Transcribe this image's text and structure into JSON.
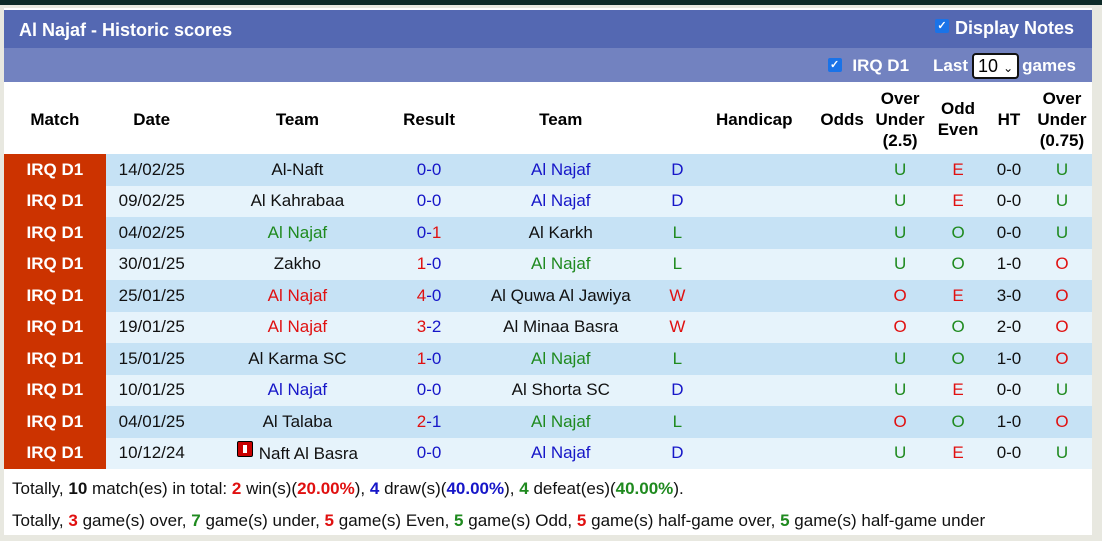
{
  "header": {
    "title": "Al Najaf - Historic scores",
    "display_notes_label": "Display Notes",
    "display_notes_checked": true
  },
  "filter": {
    "league_label": "IRQ D1",
    "league_checked": true,
    "last_label": "Last",
    "games_count": "10",
    "games_label": "games"
  },
  "columns": [
    "Match",
    "Date",
    "Team",
    "Result",
    "Team",
    "Handicap",
    "Odds",
    "Over Under (2.5)",
    "Odd Even",
    "HT",
    "Over Under (0.75)"
  ],
  "colors": {
    "league_bg": "#cc3300",
    "win": "#e01010",
    "draw": "#1616c8",
    "loss": "#1f8a1f"
  },
  "rows": [
    {
      "league": "IRQ D1",
      "date": "14/02/25",
      "home": "Al-Naft",
      "home_color": "",
      "hs": "0",
      "as": "0",
      "score_color": "blue",
      "away": "Al Najaf",
      "away_color": "blue",
      "wl": "D",
      "wl_color": "blue",
      "handicap": "",
      "odds": "",
      "ou": "U",
      "ou_color": "green",
      "oe": "E",
      "oe_color": "red",
      "ht": "0-0",
      "ou2": "U",
      "ou2_color": "green"
    },
    {
      "league": "IRQ D1",
      "date": "09/02/25",
      "home": "Al Kahrabaa",
      "home_color": "",
      "hs": "0",
      "as": "0",
      "score_color": "blue",
      "away": "Al Najaf",
      "away_color": "blue",
      "wl": "D",
      "wl_color": "blue",
      "handicap": "",
      "odds": "",
      "ou": "U",
      "ou_color": "green",
      "oe": "E",
      "oe_color": "red",
      "ht": "0-0",
      "ou2": "U",
      "ou2_color": "green"
    },
    {
      "league": "IRQ D1",
      "date": "04/02/25",
      "home": "Al Najaf",
      "home_color": "green",
      "hs": "0",
      "as": "1",
      "score_color": "away-red",
      "away": "Al Karkh",
      "away_color": "",
      "wl": "L",
      "wl_color": "green",
      "handicap": "",
      "odds": "",
      "ou": "U",
      "ou_color": "green",
      "oe": "O",
      "oe_color": "green",
      "ht": "0-0",
      "ou2": "U",
      "ou2_color": "green"
    },
    {
      "league": "IRQ D1",
      "date": "30/01/25",
      "home": "Zakho",
      "home_color": "",
      "hs": "1",
      "as": "0",
      "score_color": "home-red",
      "away": "Al Najaf",
      "away_color": "green",
      "wl": "L",
      "wl_color": "green",
      "handicap": "",
      "odds": "",
      "ou": "U",
      "ou_color": "green",
      "oe": "O",
      "oe_color": "green",
      "ht": "1-0",
      "ou2": "O",
      "ou2_color": "red"
    },
    {
      "league": "IRQ D1",
      "date": "25/01/25",
      "home": "Al Najaf",
      "home_color": "red",
      "hs": "4",
      "as": "0",
      "score_color": "home-red",
      "away": "Al Quwa Al Jawiya",
      "away_color": "",
      "wl": "W",
      "wl_color": "red",
      "handicap": "",
      "odds": "",
      "ou": "O",
      "ou_color": "red",
      "oe": "E",
      "oe_color": "red",
      "ht": "3-0",
      "ou2": "O",
      "ou2_color": "red"
    },
    {
      "league": "IRQ D1",
      "date": "19/01/25",
      "home": "Al Najaf",
      "home_color": "red",
      "hs": "3",
      "as": "2",
      "score_color": "home-red",
      "away": "Al Minaa Basra",
      "away_color": "",
      "wl": "W",
      "wl_color": "red",
      "handicap": "",
      "odds": "",
      "ou": "O",
      "ou_color": "red",
      "oe": "O",
      "oe_color": "green",
      "ht": "2-0",
      "ou2": "O",
      "ou2_color": "red"
    },
    {
      "league": "IRQ D1",
      "date": "15/01/25",
      "home": "Al Karma SC",
      "home_color": "",
      "hs": "1",
      "as": "0",
      "score_color": "home-red",
      "away": "Al Najaf",
      "away_color": "green",
      "wl": "L",
      "wl_color": "green",
      "handicap": "",
      "odds": "",
      "ou": "U",
      "ou_color": "green",
      "oe": "O",
      "oe_color": "green",
      "ht": "1-0",
      "ou2": "O",
      "ou2_color": "red"
    },
    {
      "league": "IRQ D1",
      "date": "10/01/25",
      "home": "Al Najaf",
      "home_color": "blue",
      "hs": "0",
      "as": "0",
      "score_color": "blue",
      "away": "Al Shorta SC",
      "away_color": "",
      "wl": "D",
      "wl_color": "blue",
      "handicap": "",
      "odds": "",
      "ou": "U",
      "ou_color": "green",
      "oe": "E",
      "oe_color": "red",
      "ht": "0-0",
      "ou2": "U",
      "ou2_color": "green"
    },
    {
      "league": "IRQ D1",
      "date": "04/01/25",
      "home": "Al Talaba",
      "home_color": "",
      "hs": "2",
      "as": "1",
      "score_color": "home-red",
      "away": "Al Najaf",
      "away_color": "green",
      "wl": "L",
      "wl_color": "green",
      "handicap": "",
      "odds": "",
      "ou": "O",
      "ou_color": "red",
      "oe": "O",
      "oe_color": "green",
      "ht": "1-0",
      "ou2": "O",
      "ou2_color": "red"
    },
    {
      "league": "IRQ D1",
      "date": "10/12/24",
      "home": "Naft Al Basra",
      "home_color": "",
      "home_card": "red-card-icon",
      "hs": "0",
      "as": "0",
      "score_color": "blue",
      "away": "Al Najaf",
      "away_color": "blue",
      "wl": "D",
      "wl_color": "blue",
      "handicap": "",
      "odds": "",
      "ou": "U",
      "ou_color": "green",
      "oe": "E",
      "oe_color": "red",
      "ht": "0-0",
      "ou2": "U",
      "ou2_color": "green"
    }
  ],
  "summary": {
    "line1": {
      "prefix": "Totally,",
      "total": "10",
      "t1": "match(es) in total:",
      "wins": "2",
      "t2": "win(s)(",
      "win_pct": "20.00%",
      "t3": "),",
      "draws": "4",
      "t4": "draw(s)(",
      "draw_pct": "40.00%",
      "t5": "),",
      "defeats": "4",
      "t6": "defeat(es)(",
      "defeat_pct": "40.00%",
      "t7": ")."
    },
    "line2": {
      "prefix": "Totally,",
      "over": "3",
      "t1": "game(s) over,",
      "under": "7",
      "t2": "game(s) under,",
      "even": "5",
      "t3": "game(s) Even,",
      "odd": "5",
      "t4": "game(s) Odd,",
      "half_over": "5",
      "t5": "game(s) half-game over,",
      "half_under": "5",
      "t6": "game(s) half-game under"
    }
  }
}
